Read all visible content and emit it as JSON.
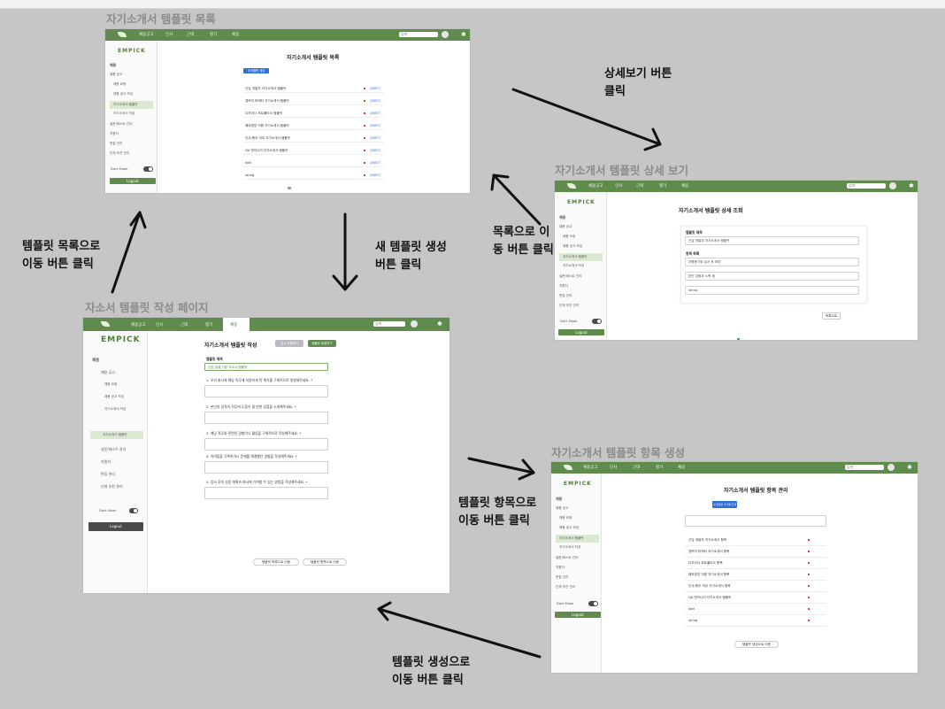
{
  "diagram_title_list": "자기소개서 템플릿 목록",
  "diagram_title_detail": "자기소개서 템플릿 상세 보기",
  "diagram_title_write": "자소서 템플릿 작성 페이지",
  "diagram_title_items": "자기소개서 템플릿 항목 생성",
  "annotations": {
    "detail_btn": [
      "상세보기 버튼",
      "클릭"
    ],
    "back_to_list": [
      "목록으로 이",
      "동 버튼 클릭"
    ],
    "new_template": [
      "새 템플릿 생성",
      "버튼 클릭"
    ],
    "to_list": [
      "템플릿 목록으로",
      "이동 버튼 클릭"
    ],
    "to_items": [
      "템플릿 항목으로",
      "이동 버튼 클릭"
    ],
    "to_create": [
      "템플릿 생성으로",
      "이동 버튼 클릭"
    ]
  },
  "brand": {
    "logo": "EMPICK",
    "accent": "#5f8b4c"
  },
  "nav": {
    "items": [
      "채용공고",
      "인사",
      "근태",
      "평가",
      "채용"
    ],
    "search_placeholder": "검색"
  },
  "sidebar": {
    "section": "채용",
    "items": [
      "채용 공고",
      "채용 요청",
      "채용 공고 작성",
      "자기소개서 템플릿",
      "자기소개서 작성",
      "설문/테스트 관리",
      "지원자",
      "면접 관리",
      "인재 추천 관리"
    ],
    "darkmode": "Dark Mode",
    "logout": "Logout"
  },
  "list_page": {
    "title": "자기소개서 템플릿 목록",
    "new_button": "새 템플릿 생성",
    "rows": [
      "신입 개발자 자기소개서 템플릿",
      "경력직 마케터 자기소개서 템플릿",
      "디자이너 포트폴리오 템플릿",
      "해외영업 지원 자기소개서 템플릿",
      "인사/총무 직무 자기소개서 템플릿",
      "QA 엔지니어 자기소개서 템플릿",
      "ddd",
      "string"
    ],
    "row_action": "상세보기"
  },
  "detail_page": {
    "title": "자기소개서 템플릿 상세 조회",
    "name_label": "템플릿 제목",
    "name_value": "신입 개발자 자기소개서 템플릿",
    "items_label": "항목 목록",
    "items": [
      "지원동기와 입사 후 포부",
      "본인 강점과 노력 점",
      "string"
    ],
    "back_button": "목록으로"
  },
  "write_page": {
    "title": "자기소개서 템플릿 작성",
    "btn_temp": "임시 저장하기",
    "btn_save": "템플릿 등록하기",
    "name_label": "템플릿 제목",
    "name_value": "신입 공채 기본 자소서 템플릿",
    "questions": [
      "1. 우리 회사에 해당 직무에 지원하게 된 계기를 구체적으로 말씀해주세요. *",
      "2. 본인의 성격과 직무에 도움이 될 만한 강점을 소개해주세요. *",
      "3. 해당 직무와 관련된 경험이나 활동을 구체적으로 작성해주세요. *",
      "4. 어려움을 극복하거나 문제를 해결했던 경험을 작성해주세요. *",
      "5. 입사 후의 성장 계획과 회사에 기여할 수 있는 방법을 작성해주세요. *"
    ],
    "footer_list": "템플릿 목록으로 이동",
    "footer_items": "템플릿 항목으로 이동"
  },
  "items_page": {
    "title": "자기소개서 템플릿 항목 관리",
    "add_button": "새 항목을 추가해 주세요",
    "rows": [
      "신입 개발자 자기소개서 항목",
      "경력직 마케터 자기소개서 항목",
      "디자이너 포트폴리오 항목",
      "해외영업 지원 자기소개서 항목",
      "인사/총무 직무 자기소개서 항목",
      "QA 엔지니어 자기소개서 템플릿",
      "ddd",
      "string"
    ],
    "footer": "템플릿 생성으로 이동"
  }
}
